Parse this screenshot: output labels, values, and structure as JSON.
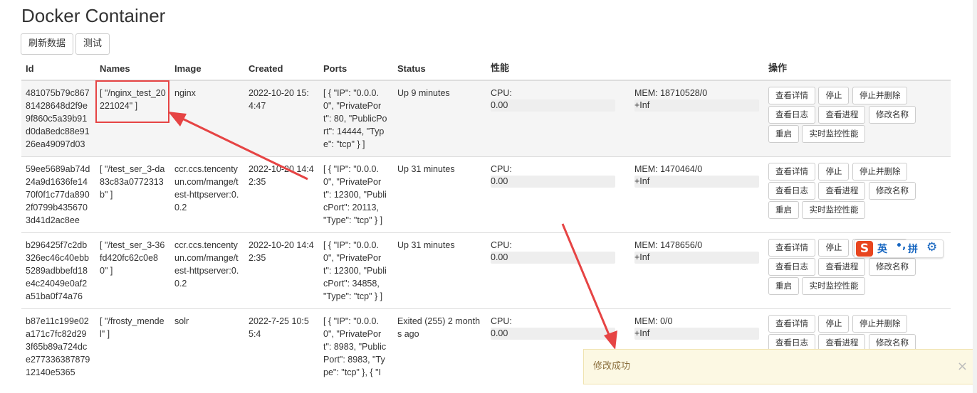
{
  "title": "Docker Container",
  "toolbar": {
    "refresh_label": "刷新数据",
    "test_label": "测试"
  },
  "columns": {
    "id": "Id",
    "names": "Names",
    "image": "Image",
    "created": "Created",
    "ports": "Ports",
    "status": "Status",
    "perf": "性能",
    "ops": "操作"
  },
  "actions": {
    "details": "查看详情",
    "stop": "停止",
    "stop_delete": "停止并删除",
    "logs": "查看日志",
    "processes": "查看进程",
    "rename": "修改名称",
    "restart": "重启",
    "monitor": "实时监控性能"
  },
  "rows": [
    {
      "id": "481075b79c86781428648d2f9e9f860c5a39b91d0da8edc88e9126ea49097d03",
      "names": "[ \"/nginx_test_20221024\" ]",
      "image": "nginx",
      "created": "2022-10-20 15:4:47",
      "ports": "[ { \"IP\": \"0.0.0.0\", \"PrivatePort\": 80, \"PublicPort\": 14444, \"Type\": \"tcp\" } ]",
      "status": "Up 9 minutes",
      "cpu_label": "CPU:",
      "cpu_value": "0.00",
      "mem_label": "MEM: 18710528/0",
      "mem_value": "+Inf"
    },
    {
      "id": "59ee5689ab74d24a9d1636fe1470f0f1c77da8902f0799b4356703d41d2ac8ee",
      "names": "[ \"/test_ser_3-da83c83a0772313b\" ]",
      "image": "ccr.ccs.tencentyun.com/mange/test-httpserver:0.0.2",
      "created": "2022-10-20 14:42:35",
      "ports": "[ { \"IP\": \"0.0.0.0\", \"PrivatePort\": 12300, \"PublicPort\": 20113, \"Type\": \"tcp\" } ]",
      "status": "Up 31 minutes",
      "cpu_label": "CPU:",
      "cpu_value": "0.00",
      "mem_label": "MEM: 1470464/0",
      "mem_value": "+Inf"
    },
    {
      "id": "b296425f7c2db326ec46c40ebb5289adbbefd18e4c24049e0af2a51ba0f74a76",
      "names": "[ \"/test_ser_3-36fd420fc62c0e80\" ]",
      "image": "ccr.ccs.tencentyun.com/mange/test-httpserver:0.0.2",
      "created": "2022-10-20 14:42:35",
      "ports": "[ { \"IP\": \"0.0.0.0\", \"PrivatePort\": 12300, \"PublicPort\": 34858, \"Type\": \"tcp\" } ]",
      "status": "Up 31 minutes",
      "cpu_label": "CPU:",
      "cpu_value": "0.00",
      "mem_label": "MEM: 1478656/0",
      "mem_value": "+Inf"
    },
    {
      "id": "b87e11c199e02a171c7fc82d293f65b89a724dce27733638787912140e5365",
      "names": "[ \"/frosty_mendel\" ]",
      "image": "solr",
      "created": "2022-7-25 10:55:4",
      "ports": "[ { \"IP\": \"0.0.0.0\", \"PrivatePort\": 8983, \"PublicPort\": 8983, \"Type\": \"tcp\" }, { \"I",
      "status": "Exited (255) 2 months ago",
      "cpu_label": "CPU:",
      "cpu_value": "0.00",
      "mem_label": "MEM: 0/0",
      "mem_value": "+Inf"
    }
  ],
  "toast": {
    "message": "修改成功",
    "close": "×"
  },
  "ime": {
    "logo": "S",
    "lang": "英",
    "punct": "•,",
    "mode": "拼",
    "settings": "⚙"
  }
}
